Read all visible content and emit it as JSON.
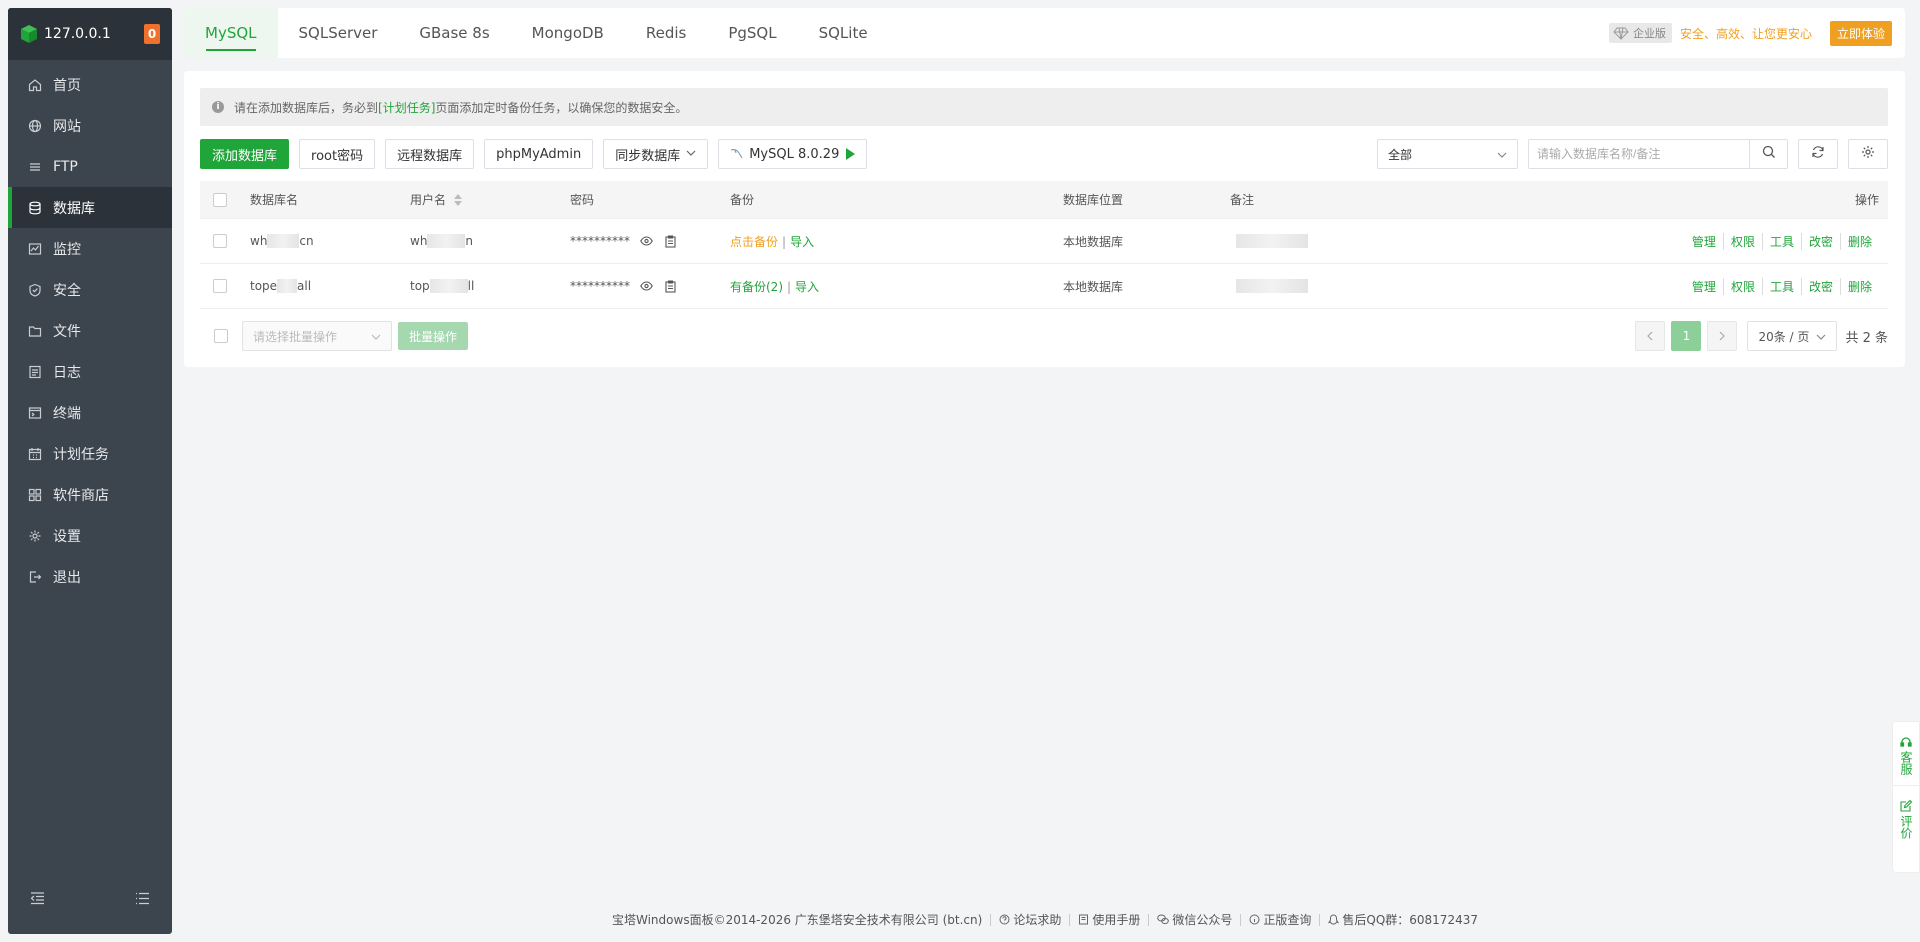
{
  "sidebar": {
    "host": "127.0.0.1",
    "badge": "0",
    "items": [
      {
        "label": "首页",
        "icon": "home-icon"
      },
      {
        "label": "网站",
        "icon": "globe-icon"
      },
      {
        "label": "FTP",
        "icon": "ftp-icon"
      },
      {
        "label": "数据库",
        "icon": "database-icon",
        "active": true
      },
      {
        "label": "监控",
        "icon": "monitor-icon"
      },
      {
        "label": "安全",
        "icon": "shield-icon"
      },
      {
        "label": "文件",
        "icon": "folder-icon"
      },
      {
        "label": "日志",
        "icon": "log-icon"
      },
      {
        "label": "终端",
        "icon": "terminal-icon"
      },
      {
        "label": "计划任务",
        "icon": "calendar-icon"
      },
      {
        "label": "软件商店",
        "icon": "apps-icon"
      },
      {
        "label": "设置",
        "icon": "gear-icon"
      },
      {
        "label": "退出",
        "icon": "logout-icon"
      }
    ]
  },
  "tabs": [
    "MySQL",
    "SQLServer",
    "GBase 8s",
    "MongoDB",
    "Redis",
    "PgSQL",
    "SQLite"
  ],
  "promo": {
    "edition": "企业版",
    "slogan": "安全、高效、让您更安心",
    "try_label": "立即体验"
  },
  "notice": {
    "before": "请在添加数据库后，务必到",
    "link": "[计划任务]",
    "after": "页面添加定时备份任务，以确保您的数据安全。"
  },
  "toolbar": {
    "add_db": "添加数据库",
    "root_pwd": "root密码",
    "remote_db": "远程数据库",
    "phpmyadmin": "phpMyAdmin",
    "sync_db": "同步数据库",
    "mysql_version": "MySQL 8.0.29",
    "filter_value": "全部",
    "search_placeholder": "请输入数据库名称/备注"
  },
  "table": {
    "headers": {
      "name": "数据库名",
      "user": "用户名",
      "password": "密码",
      "backup": "备份",
      "location": "数据库位置",
      "note": "备注",
      "actions": "操作"
    },
    "rows": [
      {
        "name_a": "wh",
        "name_b": "cn",
        "user_a": "wh",
        "user_b": "n",
        "password": "**********",
        "backup": "点击备份",
        "backup_color": "#f0a020",
        "import": "导入",
        "location": "本地数据库"
      },
      {
        "name_a": "tope",
        "name_b": "all",
        "user_a": "top",
        "user_b": "ll",
        "password": "**********",
        "backup": "有备份(2)",
        "backup_color": "#20a53a",
        "import": "导入",
        "location": "本地数据库"
      }
    ],
    "actions": [
      "管理",
      "权限",
      "工具",
      "改密",
      "删除"
    ]
  },
  "bulk": {
    "placeholder": "请选择批量操作",
    "button": "批量操作"
  },
  "pagination": {
    "current": "1",
    "per_page": "20条 / 页",
    "total": "共 2 条"
  },
  "float": {
    "service": "客服",
    "review": "评价"
  },
  "footer": {
    "copyright": "宝塔Windows面板©2014-2026 广东堡塔安全技术有限公司 (bt.cn)",
    "forum": "论坛求助",
    "manual": "使用手册",
    "wechat": "微信公众号",
    "license": "正版查询",
    "qq_group": "售后QQ群：608172437"
  },
  "colors": {
    "accent": "#20a53a",
    "warning": "#f0a020",
    "sidebar_bg": "#3c444d",
    "sidebar_head": "#2c323a"
  }
}
